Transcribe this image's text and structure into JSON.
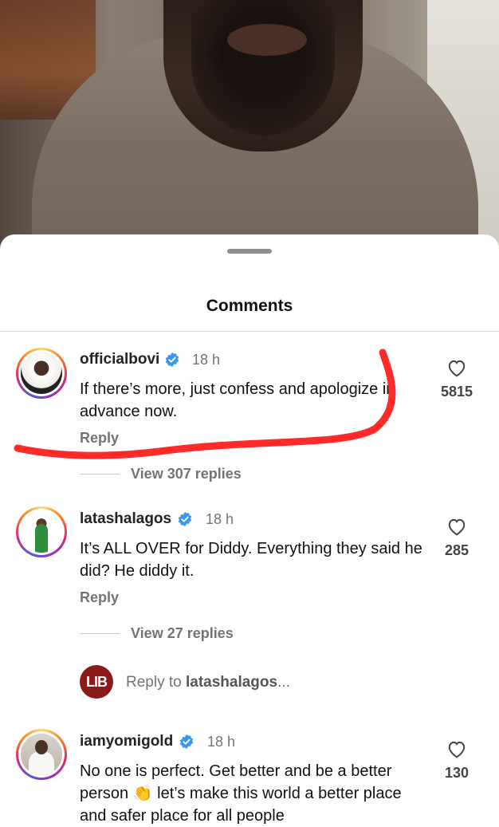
{
  "sheet": {
    "title": "Comments"
  },
  "comments": [
    {
      "username": "officialbovi",
      "time": "18 h",
      "text": "If there’s more, just confess and apologize in advance now.",
      "reply_label": "Reply",
      "likes": "5815",
      "view_replies": "View 307 replies"
    },
    {
      "username": "latashalagos",
      "time": "18 h",
      "text": "It’s ALL OVER for Diddy. Everything they said he did? He diddy it.",
      "reply_label": "Reply",
      "likes": "285",
      "view_replies": "View 27 replies"
    },
    {
      "username": "iamyomigold",
      "time": "18 h",
      "text": "No one is perfect. Get better and be a better person 👏 let’s make this world a better place and safer place for all people",
      "likes": "130"
    }
  ],
  "reply_prompt": {
    "avatar_text": "LIB",
    "prefix": "Reply to ",
    "target": "latashalagos",
    "suffix": "..."
  },
  "colors": {
    "accent_verified": "#3897f0",
    "annotation": "#ff2a2a"
  },
  "icons": {
    "verified": "verified-badge-icon",
    "like": "heart-outline-icon"
  }
}
